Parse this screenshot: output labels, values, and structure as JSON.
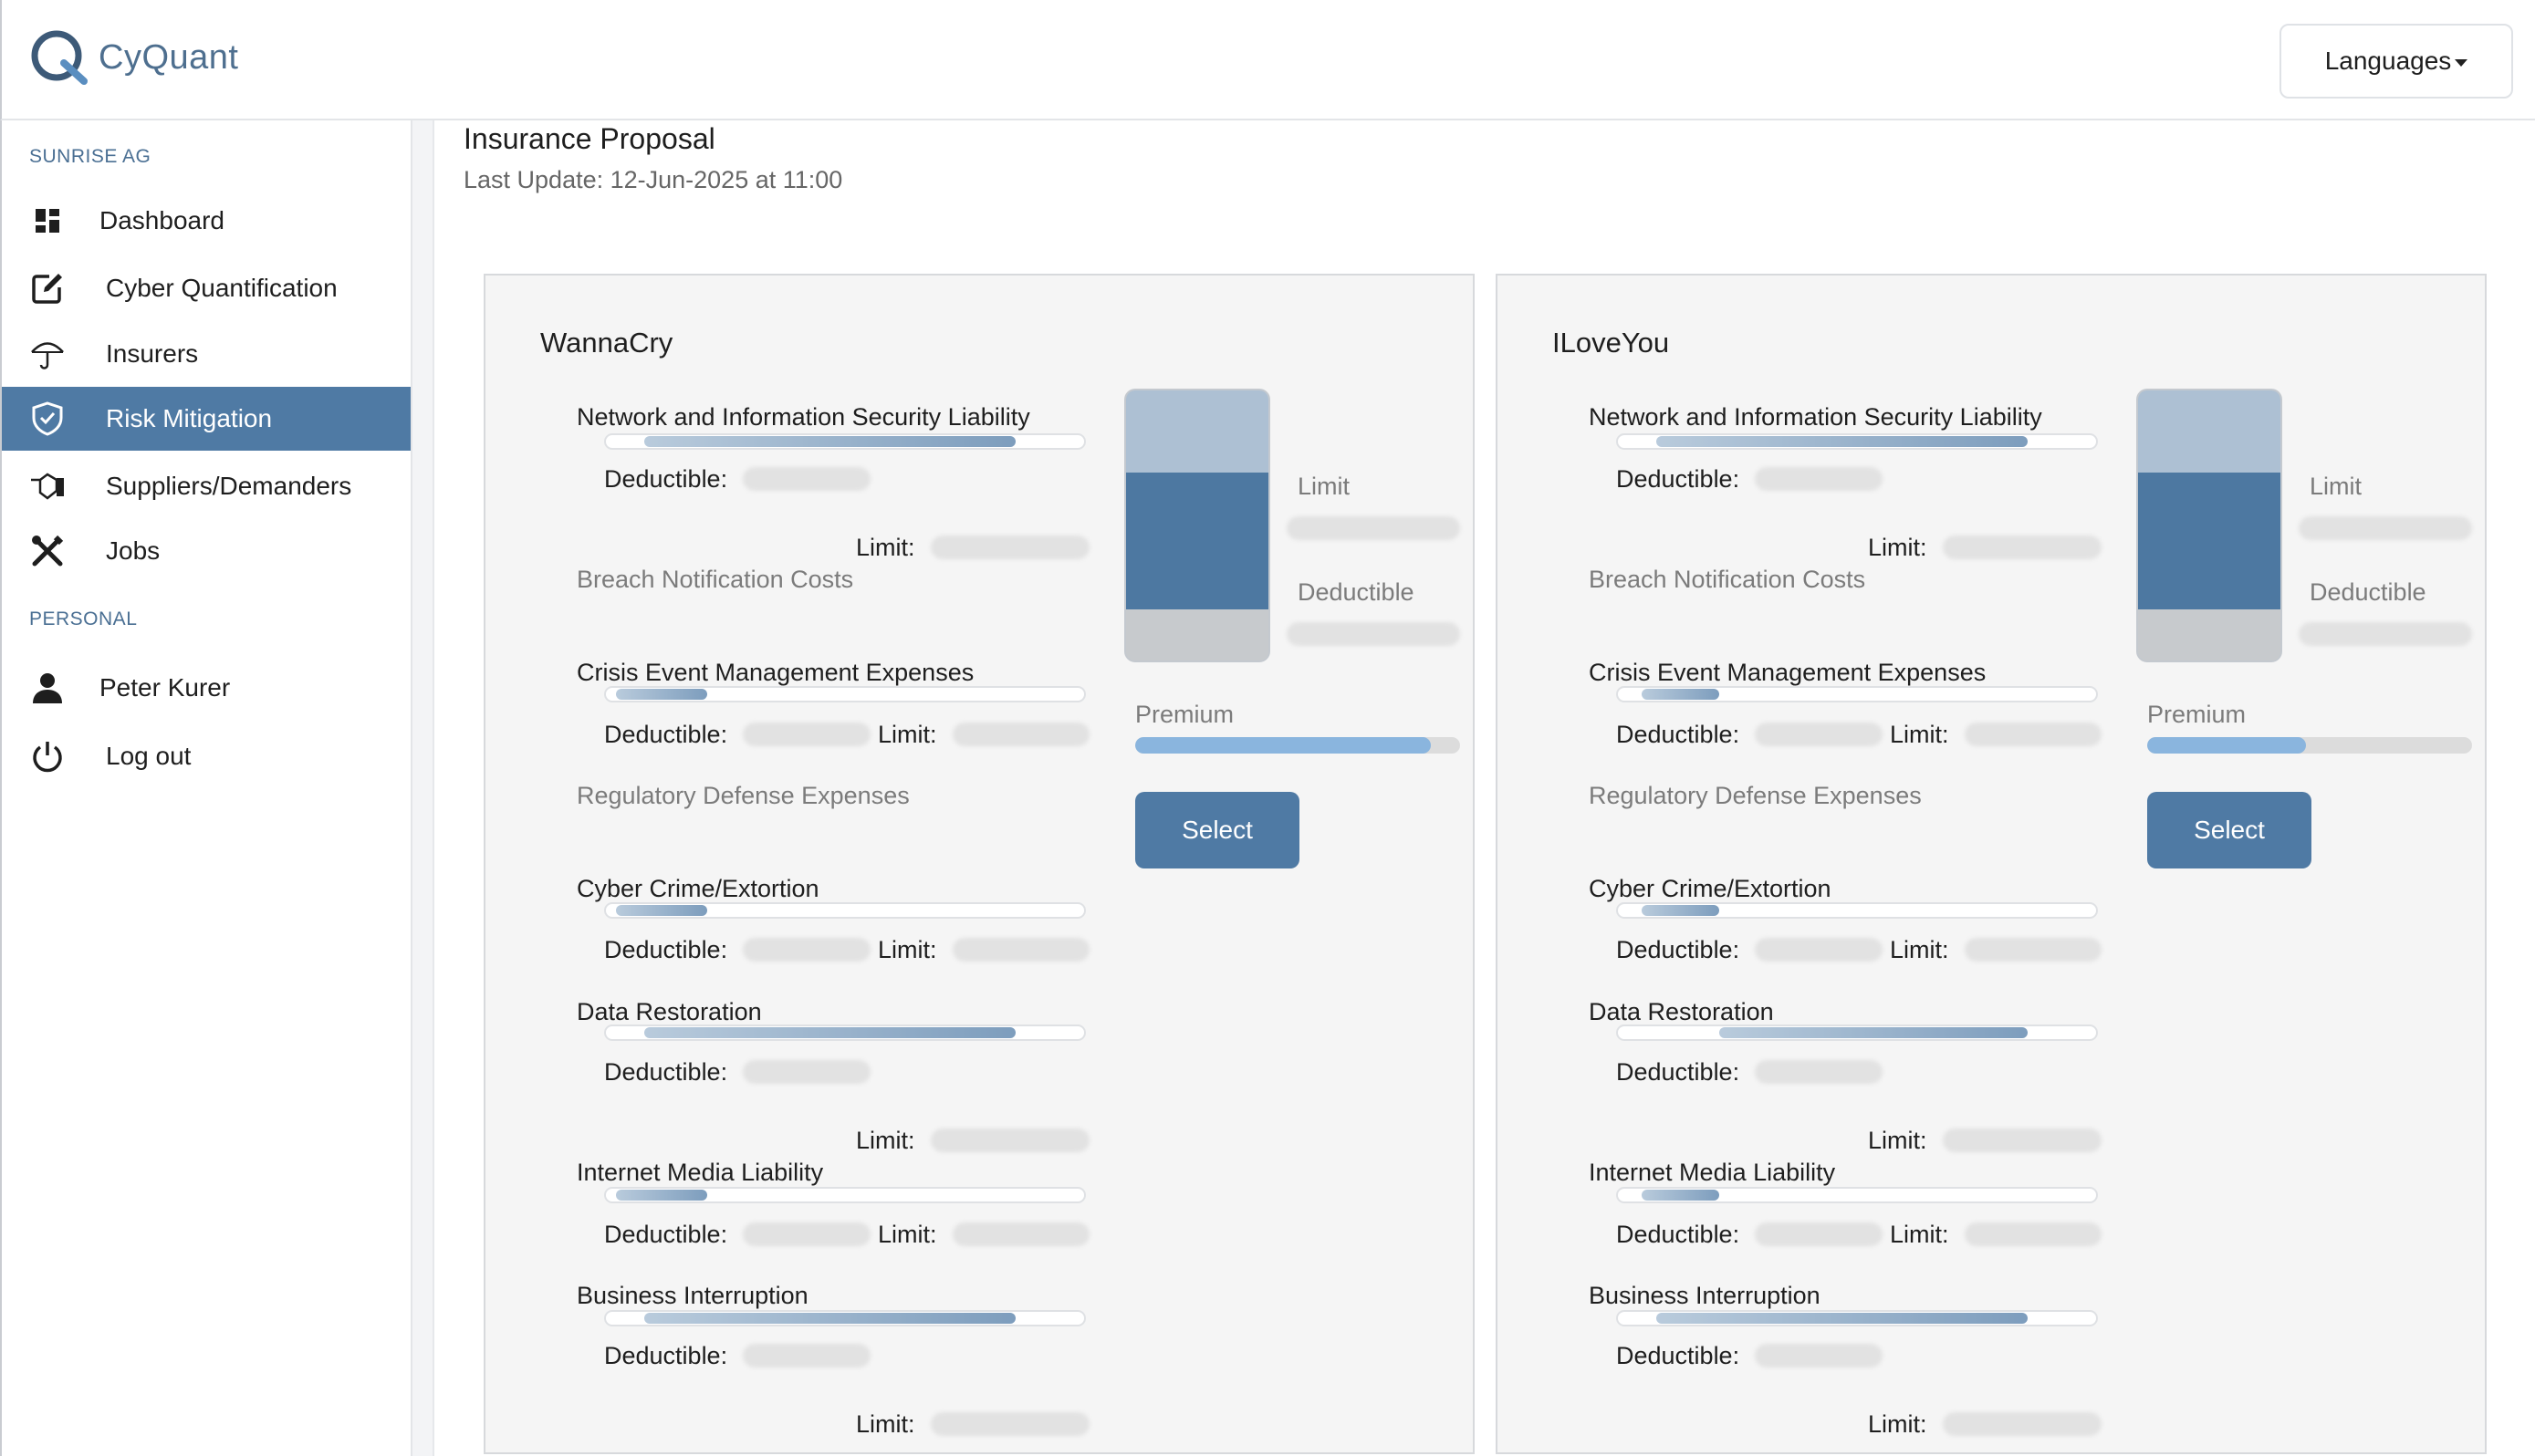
{
  "app": {
    "logo_text": "CyQuant"
  },
  "header": {
    "languages_label": "Languages"
  },
  "sidebar": {
    "org_section": "SUNRISE AG",
    "personal_section": "PERSONAL",
    "items": [
      {
        "label": "Dashboard",
        "icon": "dashboard-icon"
      },
      {
        "label": "Cyber Quantification",
        "icon": "edit-square-icon"
      },
      {
        "label": "Insurers",
        "icon": "umbrella-icon"
      },
      {
        "label": "Risk Mitigation",
        "icon": "shield-check-icon",
        "active": true
      },
      {
        "label": "Suppliers/Demanders",
        "icon": "handshake-icon"
      },
      {
        "label": "Jobs",
        "icon": "tools-icon"
      }
    ],
    "personal_items": [
      {
        "label": "Peter Kurer",
        "icon": "user-icon"
      },
      {
        "label": "Log out",
        "icon": "power-icon"
      }
    ]
  },
  "main": {
    "title": "Insurance Proposal",
    "last_update": "Last Update: 12-Jun-2025 at 11:00"
  },
  "proposals": [
    {
      "name": "WannaCry",
      "limit_label": "Limit",
      "deductible_label": "Deductible",
      "premium_label": "Premium",
      "premium_fraction": 0.91,
      "select_label": "Select",
      "coverages": [
        {
          "name": "Network and Information Security Liability",
          "active": true,
          "range": [
            0.08,
            0.85
          ],
          "deductible_label": "Deductible:",
          "limit_label": "Limit:"
        },
        {
          "name": "Breach Notification Costs",
          "active": false
        },
        {
          "name": "Crisis Event Management Expenses",
          "active": true,
          "range": [
            0.02,
            0.21
          ],
          "deductible_label": "Deductible:",
          "limit_label": "Limit:"
        },
        {
          "name": "Regulatory Defense Expenses",
          "active": false
        },
        {
          "name": "Cyber Crime/Extortion",
          "active": true,
          "range": [
            0.02,
            0.21
          ],
          "deductible_label": "Deductible:",
          "limit_label": "Limit:"
        },
        {
          "name": "Data Restoration",
          "active": true,
          "range": [
            0.08,
            0.85
          ],
          "deductible_label": "Deductible:",
          "limit_label": "Limit:"
        },
        {
          "name": "Internet Media Liability",
          "active": true,
          "range": [
            0.02,
            0.21
          ],
          "deductible_label": "Deductible:",
          "limit_label": "Limit:"
        },
        {
          "name": "Business Interruption",
          "active": true,
          "range": [
            0.08,
            0.85
          ],
          "deductible_label": "Deductible:",
          "limit_label": "Limit:"
        }
      ]
    },
    {
      "name": "ILoveYou",
      "limit_label": "Limit",
      "deductible_label": "Deductible",
      "premium_label": "Premium",
      "premium_fraction": 0.49,
      "select_label": "Select",
      "coverages": [
        {
          "name": "Network and Information Security Liability",
          "active": true,
          "range": [
            0.08,
            0.85
          ],
          "deductible_label": "Deductible:",
          "limit_label": "Limit:"
        },
        {
          "name": "Breach Notification Costs",
          "active": false
        },
        {
          "name": "Crisis Event Management Expenses",
          "active": true,
          "range": [
            0.05,
            0.21
          ],
          "deductible_label": "Deductible:",
          "limit_label": "Limit:"
        },
        {
          "name": "Regulatory Defense Expenses",
          "active": false
        },
        {
          "name": "Cyber Crime/Extortion",
          "active": true,
          "range": [
            0.05,
            0.21
          ],
          "deductible_label": "Deductible:",
          "limit_label": "Limit:"
        },
        {
          "name": "Data Restoration",
          "active": true,
          "range": [
            0.21,
            0.85
          ],
          "deductible_label": "Deductible:",
          "limit_label": "Limit:"
        },
        {
          "name": "Internet Media Liability",
          "active": true,
          "range": [
            0.05,
            0.21
          ],
          "deductible_label": "Deductible:",
          "limit_label": "Limit:"
        },
        {
          "name": "Business Interruption",
          "active": true,
          "range": [
            0.08,
            0.85
          ],
          "deductible_label": "Deductible:",
          "limit_label": "Limit:"
        }
      ]
    }
  ]
}
